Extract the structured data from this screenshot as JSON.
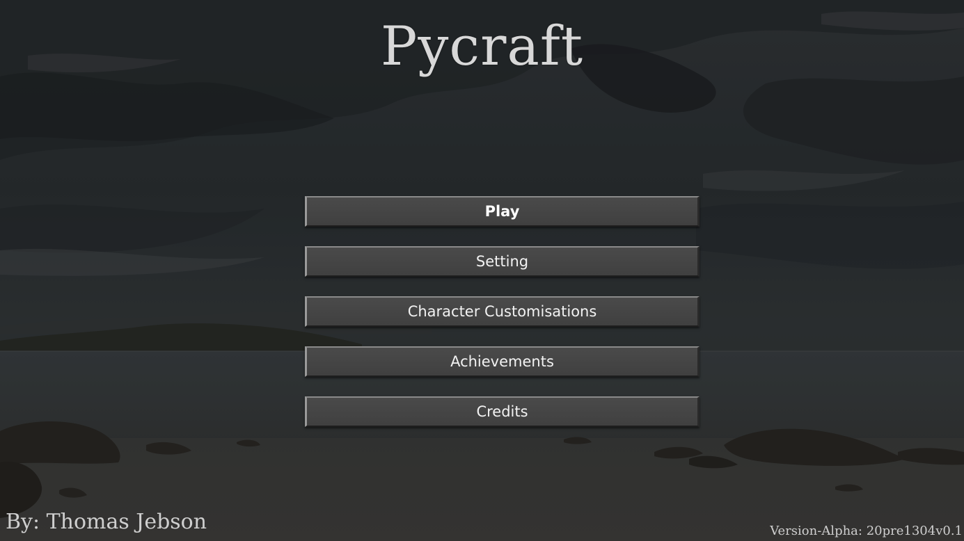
{
  "app": {
    "title": "Pycraft",
    "author": "By: Thomas Jebson",
    "version": "Version-Alpha: 20pre1304v0.1"
  },
  "menu": {
    "items": [
      {
        "label": "Play",
        "active": true
      },
      {
        "label": "Setting",
        "active": false
      },
      {
        "label": "Character Customisations",
        "active": false
      },
      {
        "label": "Achievements",
        "active": false
      },
      {
        "label": "Credits",
        "active": false
      }
    ]
  },
  "colors": {
    "button_face": "#444444",
    "text": "#f2f2f2",
    "title_text": "#d8d8d8",
    "background": "#2a2d30"
  },
  "background": {
    "scene": "coastal-landscape-painting"
  }
}
